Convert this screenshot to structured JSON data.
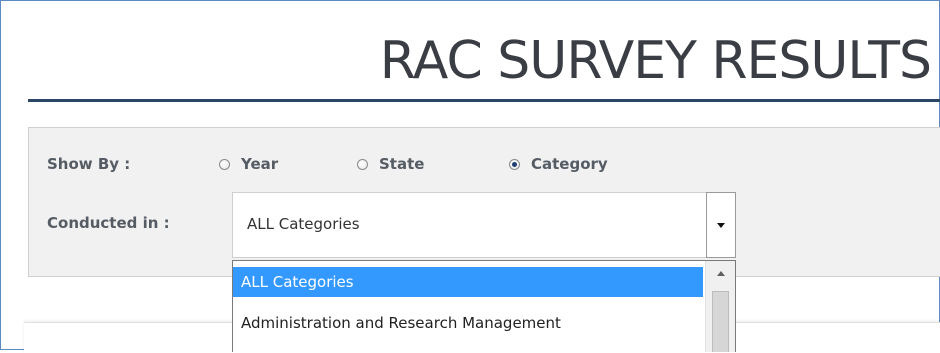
{
  "header": {
    "title": "RAC SURVEY RESULTS"
  },
  "filters": {
    "show_by_label": "Show By :",
    "show_by_options": [
      {
        "label": "Year",
        "checked": false
      },
      {
        "label": "State",
        "checked": false
      },
      {
        "label": "Category",
        "checked": true
      }
    ],
    "conducted_in_label": "Conducted in :",
    "conducted_in_selected": "ALL Categories",
    "conducted_in_options": [
      "ALL Categories",
      "Administration and Research Management"
    ]
  },
  "colors": {
    "title_text": "#3a3e44",
    "title_rule": "#2c4665",
    "label_text": "#555c64",
    "panel_bg": "#f1f1f1",
    "selected_option_bg": "#3399ff",
    "frame_border": "#5b8bc3"
  }
}
